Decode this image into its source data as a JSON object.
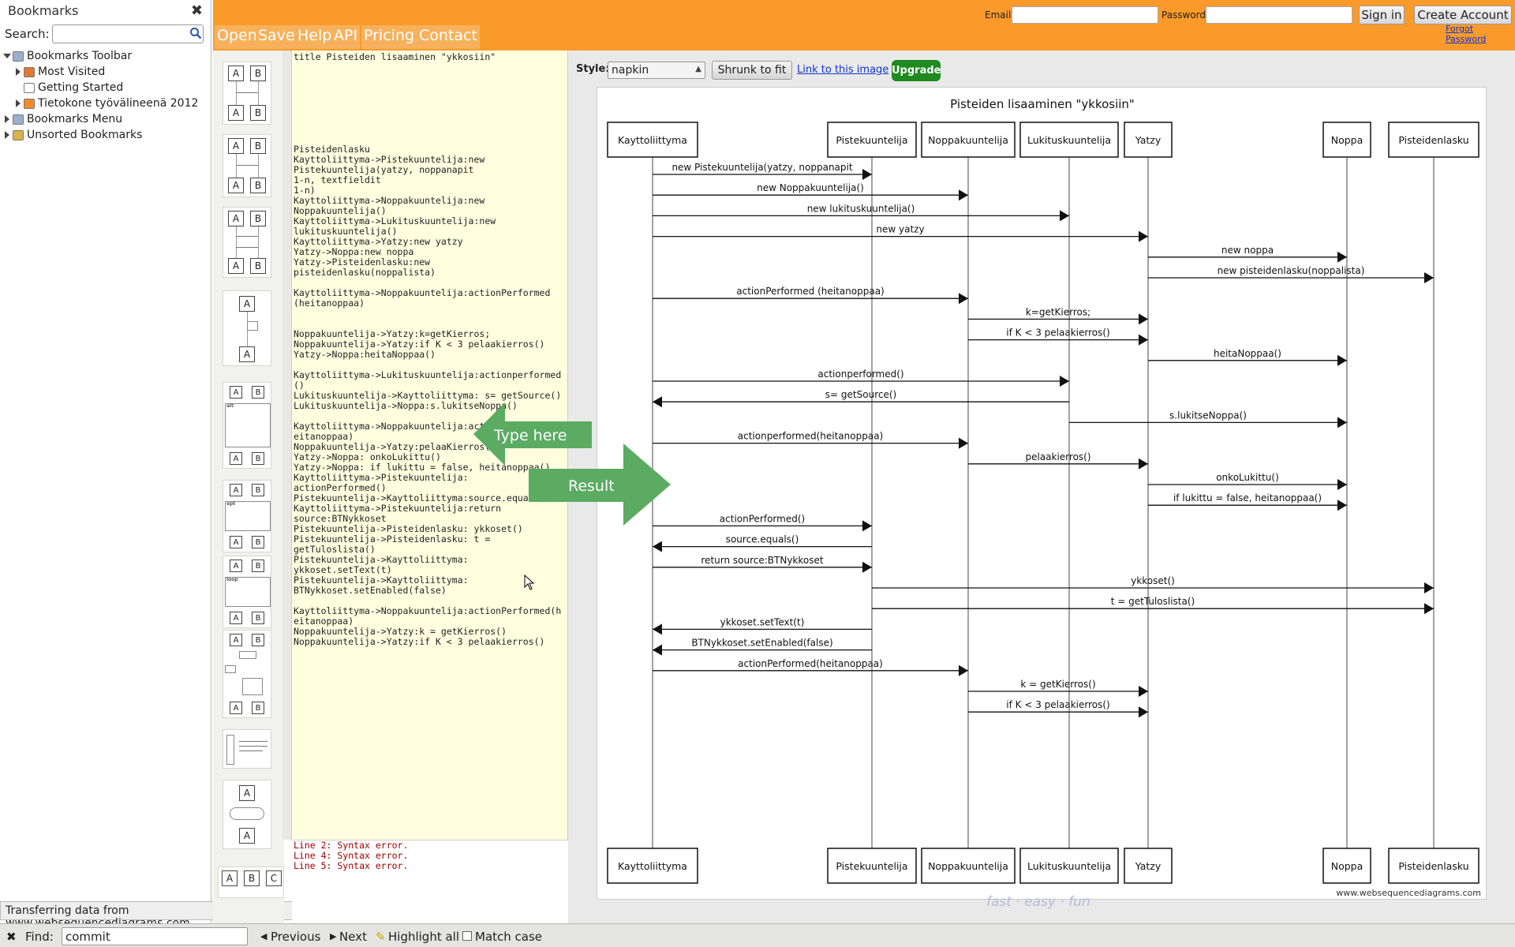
{
  "sidebar": {
    "title": "Bookmarks",
    "close_glyph": "✖",
    "search_label": "Search:",
    "search_value": "",
    "tree": [
      {
        "label": "Bookmarks Toolbar",
        "level": 0,
        "icon": "toolbar-folder-icon",
        "expanded": true
      },
      {
        "label": "Most Visited",
        "level": 1,
        "icon": "smart-folder-icon",
        "expanded": false
      },
      {
        "label": "Getting Started",
        "level": 1,
        "icon": "page-icon",
        "expanded": false
      },
      {
        "label": "Tietokone työvälineenä 2012",
        "level": 1,
        "icon": "rss-feed-icon",
        "expanded": false
      },
      {
        "label": "Bookmarks Menu",
        "level": 0,
        "icon": "menu-folder-icon",
        "expanded": false
      },
      {
        "label": "Unsorted Bookmarks",
        "level": 0,
        "icon": "unsorted-folder-icon",
        "expanded": false
      }
    ]
  },
  "status_text": "Transferring data from www.websequencediagrams.com...",
  "nav": {
    "items": [
      "Open",
      "Save",
      "Help",
      "API",
      "Pricing",
      "Contact"
    ]
  },
  "login": {
    "email_label": "Email:",
    "password_label": "Password:",
    "email_value": "",
    "password_value": "",
    "signin_label": "Sign in",
    "create_label": "Create Account",
    "forgot_label": "Forgot Password"
  },
  "editor": {
    "text": "title Pisteiden lisaaminen \"ykkosiin\"\n\n\n\n\n\n\n\n\nPisteidenlasku\nKayttoliittyma->Pistekuuntelija:new\nPistekuuntelija(yatzy, noppanapit\n1-n, textfieldit\n1-n)\nKayttoliittyma->Noppakuuntelija:new\nNoppakuuntelija()\nKayttoliittyma->Lukituskuuntelija:new\nlukituskuuntelija()\nKayttoliittyma->Yatzy:new yatzy\nYatzy->Noppa:new noppa\nYatzy->Pisteidenlasku:new\npisteidenlasku(noppalista)\n\nKayttoliittyma->Noppakuuntelija:actionPerformed\n(heitanoppaa)\n\n\nNoppakuuntelija->Yatzy:k=getKierros;\nNoppakuuntelija->Yatzy:if K < 3 pelaakierros()\nYatzy->Noppa:heitaNoppaa()\n\nKayttoliittyma->Lukituskuuntelija:actionperformed\n()\nLukituskuuntelija->Kayttoliittyma: s= getSource()\nLukituskuuntelija->Noppa:s.lukitseNoppa()\n\nKayttoliittyma->Noppakuuntelija:actionPerformed(h\neitanoppaa)\nNoppakuuntelija->Yatzy:pelaaKierros()\nYatzy->Noppa: onkoLukittu()\nYatzy->Noppa: if lukittu = false, heitanoppaa()\nKayttoliittyma->Pistekuuntelija:\nactionPerformed()\nPistekuuntelija->Kayttoliittyma:source.equals()\nKayttoliittyma->Pistekuuntelija:return\nsource:BTNykkoset\nPistekuuntelija->Pisteidenlasku: ykkoset()\nPistekuuntelija->Pisteidenlasku: t =\ngetTuloslista()\nPistekuuntelija->Kayttoliittyma:\nykkoset.setText(t)\nPistekuuntelija->Kayttoliittyma:\nBTNykkoset.setEnabled(false)\n\nKayttoliittyma->Noppakuuntelija:actionPerformed(h\neitanoppaa)\nNoppakuuntelija->Yatzy:k = getKierros()\nNoppakuuntelija->Yatzy:if K < 3 pelaakierros()",
    "errors": [
      "Line 2: Syntax error.",
      "Line 4: Syntax error.",
      "Line 5: Syntax error."
    ]
  },
  "overlay": {
    "type_here": "Type here",
    "result": "Result"
  },
  "toolbar": {
    "style_label": "Style:",
    "style_value": "napkin",
    "shrunk_label": "Shrunk to fit",
    "link_label": "Link to this image",
    "upgrade_label": "Upgrade"
  },
  "diagram": {
    "title": "Pisteiden lisaaminen \"ykkosiin\"",
    "participants": [
      "Kayttoliittyma",
      "Pistekuuntelija",
      "Noppakuuntelija",
      "Lukituskuuntelija",
      "Yatzy",
      "Noppa",
      "Pisteidenlasku"
    ],
    "messages": [
      {
        "from": 0,
        "to": 1,
        "label": "new Pistekuuntelija(yatzy, noppanapit"
      },
      {
        "from": 0,
        "to": 2,
        "label": "new Noppakuuntelija()"
      },
      {
        "from": 0,
        "to": 3,
        "label": "new lukituskuuntelija()"
      },
      {
        "from": 0,
        "to": 4,
        "label": "new yatzy"
      },
      {
        "from": 4,
        "to": 5,
        "label": "new noppa"
      },
      {
        "from": 4,
        "to": 6,
        "label": "new pisteidenlasku(noppalista)"
      },
      {
        "from": 0,
        "to": 2,
        "label": "actionPerformed (heitanoppaa)"
      },
      {
        "from": 2,
        "to": 4,
        "label": "k=getKierros;"
      },
      {
        "from": 2,
        "to": 4,
        "label": "if K < 3 pelaakierros()"
      },
      {
        "from": 4,
        "to": 5,
        "label": "heitaNoppaa()"
      },
      {
        "from": 0,
        "to": 3,
        "label": "actionperformed()"
      },
      {
        "from": 3,
        "to": 0,
        "label": "s= getSource()"
      },
      {
        "from": 3,
        "to": 5,
        "label": "s.lukitseNoppa()"
      },
      {
        "from": 0,
        "to": 2,
        "label": "actionperformed(heitanoppaa)"
      },
      {
        "from": 2,
        "to": 4,
        "label": "pelaakierros()"
      },
      {
        "from": 4,
        "to": 5,
        "label": "onkoLukittu()"
      },
      {
        "from": 4,
        "to": 5,
        "label": "if lukittu = false, heitanoppaa()"
      },
      {
        "from": 0,
        "to": 1,
        "label": "actionPerformed()"
      },
      {
        "from": 1,
        "to": 0,
        "label": "source.equals()"
      },
      {
        "from": 0,
        "to": 1,
        "label": "return source:BTNykkoset"
      },
      {
        "from": 1,
        "to": 6,
        "label": "ykkoset()"
      },
      {
        "from": 1,
        "to": 6,
        "label": "t = getTuloslista()"
      },
      {
        "from": 1,
        "to": 0,
        "label": "ykkoset.setText(t)"
      },
      {
        "from": 1,
        "to": 0,
        "label": "BTNykkoset.setEnabled(false)"
      },
      {
        "from": 0,
        "to": 2,
        "label": "actionPerformed(heitanoppaa)"
      },
      {
        "from": 2,
        "to": 4,
        "label": "k = getKierros()"
      },
      {
        "from": 2,
        "to": 4,
        "label": "if K < 3 pelaakierros()"
      }
    ],
    "watermark": "www.websequencediagrams.com"
  },
  "tagline": "fast · easy · fun",
  "findbar": {
    "close_glyph": "✖",
    "find_label": "Find:",
    "find_value": "commit",
    "previous_label": "Previous",
    "next_label": "Next",
    "highlight_label": "Highlight all",
    "matchcase_label": "Match case"
  },
  "colors": {
    "topbar": "#f99a2a",
    "editor_bg": "#ffffe0",
    "upgrade": "#1f8a1f",
    "overlay_arrow": "#5bab62",
    "error_text": "#a00000"
  }
}
